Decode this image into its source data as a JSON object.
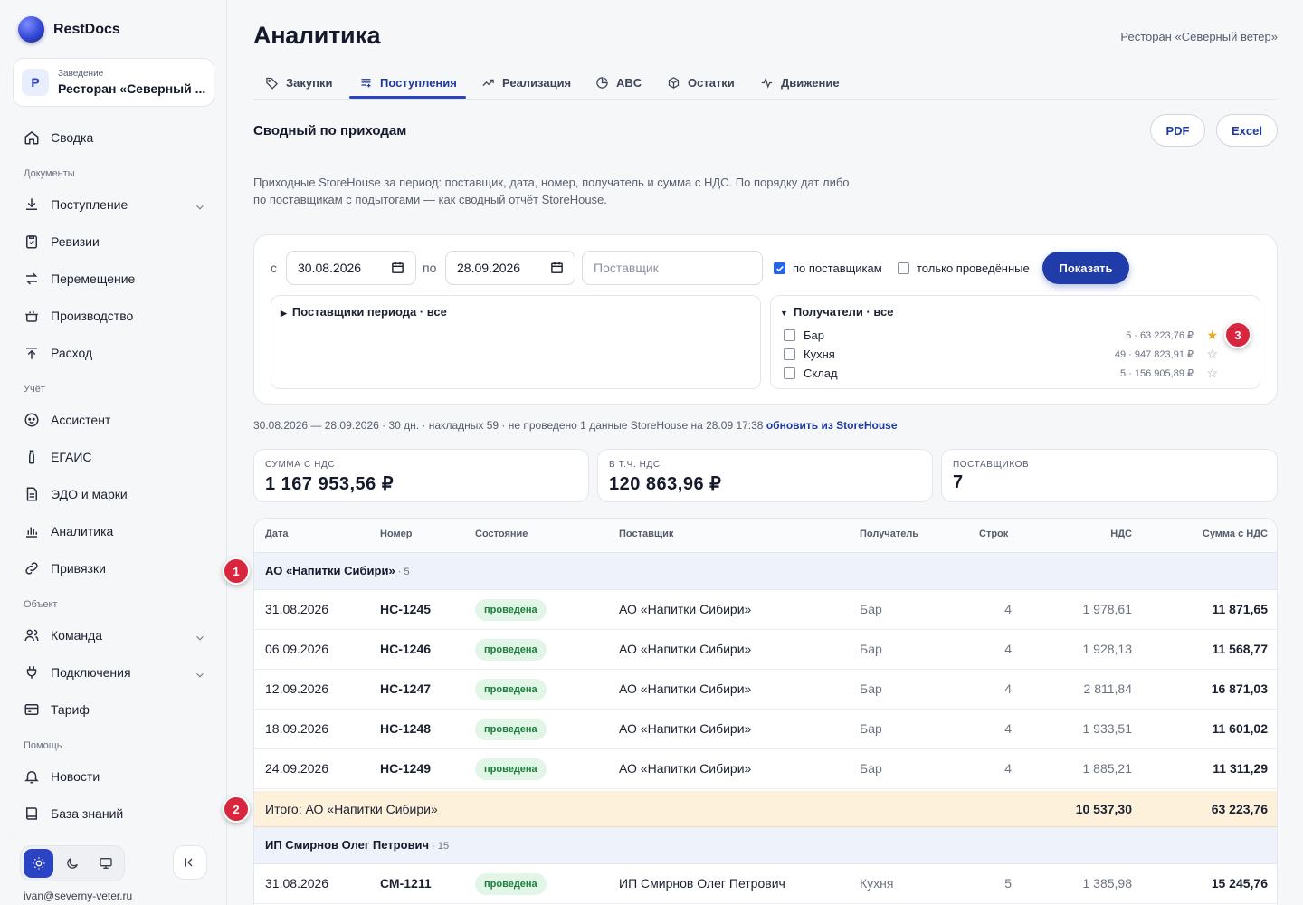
{
  "brand": {
    "name": "RestDocs"
  },
  "venue": {
    "caption": "Заведение",
    "initial": "Р",
    "name": "Ресторан «Северный ..."
  },
  "nav": {
    "summary": "Сводка",
    "sec_documents": "Документы",
    "receipt": "Поступление",
    "audits": "Ревизии",
    "transfer": "Перемещение",
    "production": "Производство",
    "expense": "Расход",
    "sec_accounting": "Учёт",
    "assistant": "Ассистент",
    "egais": "ЕГАИС",
    "edo": "ЭДО и марки",
    "analytics": "Аналитика",
    "bindings": "Привязки",
    "sec_object": "Объект",
    "team": "Команда",
    "connections": "Подключения",
    "tariff": "Тариф",
    "sec_help": "Помощь",
    "news": "Новости",
    "kb": "База знаний"
  },
  "user": {
    "email": "ivan@severny-veter.ru"
  },
  "page": {
    "title": "Аналитика",
    "venue": "Ресторан «Северный ветер»"
  },
  "tabs": [
    "Закупки",
    "Поступления",
    "Реализация",
    "ABC",
    "Остатки",
    "Движение"
  ],
  "section": {
    "title": "Сводный по приходам",
    "pdf": "PDF",
    "excel": "Excel",
    "desc_1": "Приходные StoreHouse за период: поставщик, дата, номер, получатель и сумма с НДС. По порядку дат либо",
    "desc_2": "по поставщикам с подытогами — как сводный отчёт StoreHouse."
  },
  "filter": {
    "from_label": "с",
    "from": "30.08.2026",
    "to_label": "по",
    "to": "28.09.2026",
    "supplier_placeholder": "Поставщик",
    "by_supplier": "по поставщикам",
    "by_supplier_checked": true,
    "only_posted": "только проведённые",
    "only_posted_checked": false,
    "show": "Показать",
    "suppliers_head": "Поставщики периода · все",
    "recipients_head": "Получатели · все",
    "recipients": [
      {
        "name": "Бар",
        "stats": "5 · 63 223,76 ₽",
        "fav": true
      },
      {
        "name": "Кухня",
        "stats": "49 · 947 823,91 ₽",
        "fav": false
      },
      {
        "name": "Склад",
        "stats": "5 · 156 905,89 ₽",
        "fav": false
      }
    ]
  },
  "meta": {
    "period": "30.08.2026 — 28.09.2026 · 30 дн. · накладных 59 · не проведено 1",
    "data": "данные StoreHouse на 28.09 17:38",
    "refresh": "обновить из StoreHouse"
  },
  "kpi": [
    {
      "caption": "СУММА С НДС",
      "value": "1 167 953,56 ₽"
    },
    {
      "caption": "В Т.Ч. НДС",
      "value": "120 863,96 ₽"
    },
    {
      "caption": "ПОСТАВЩИКОВ",
      "value": "7"
    }
  ],
  "table": {
    "headers": [
      "Дата",
      "Номер",
      "Состояние",
      "Поставщик",
      "Получатель",
      "Строк",
      "НДС",
      "Сумма с НДС"
    ],
    "group1": {
      "name": "АО «Напитки Сибири»",
      "count": " · 5"
    },
    "rows1": [
      {
        "date": "31.08.2026",
        "num": "НС-1245",
        "state": "проведена",
        "supplier": "АО «Напитки Сибири»",
        "recipient": "Бар",
        "lines": "4",
        "vat": "1 978,61",
        "sum": "11 871,65"
      },
      {
        "date": "06.09.2026",
        "num": "НС-1246",
        "state": "проведена",
        "supplier": "АО «Напитки Сибири»",
        "recipient": "Бар",
        "lines": "4",
        "vat": "1 928,13",
        "sum": "11 568,77"
      },
      {
        "date": "12.09.2026",
        "num": "НС-1247",
        "state": "проведена",
        "supplier": "АО «Напитки Сибири»",
        "recipient": "Бар",
        "lines": "4",
        "vat": "2 811,84",
        "sum": "16 871,03"
      },
      {
        "date": "18.09.2026",
        "num": "НС-1248",
        "state": "проведена",
        "supplier": "АО «Напитки Сибири»",
        "recipient": "Бар",
        "lines": "4",
        "vat": "1 933,51",
        "sum": "11 601,02"
      },
      {
        "date": "24.09.2026",
        "num": "НС-1249",
        "state": "проведена",
        "supplier": "АО «Напитки Сибири»",
        "recipient": "Бар",
        "lines": "4",
        "vat": "1 885,21",
        "sum": "11 311,29"
      }
    ],
    "total1": {
      "label": "Итого: АО «Напитки Сибири»",
      "vat": "10 537,30",
      "sum": "63 223,76"
    },
    "group2": {
      "name": "ИП Смирнов Олег Петрович",
      "count": " · 15"
    },
    "rows2": [
      {
        "date": "31.08.2026",
        "num": "СМ-1211",
        "state": "проведена",
        "supplier": "ИП Смирнов Олег Петрович",
        "recipient": "Кухня",
        "lines": "5",
        "vat": "1 385,98",
        "sum": "15 245,76"
      }
    ]
  },
  "markers": [
    "1",
    "2",
    "3"
  ],
  "colors": {
    "accent": "#1f3ca8",
    "marker": "#d7263d",
    "total_bg": "#fdf1dc",
    "group_bg": "#eef2fb",
    "badge_bg": "#e2f6e7"
  }
}
